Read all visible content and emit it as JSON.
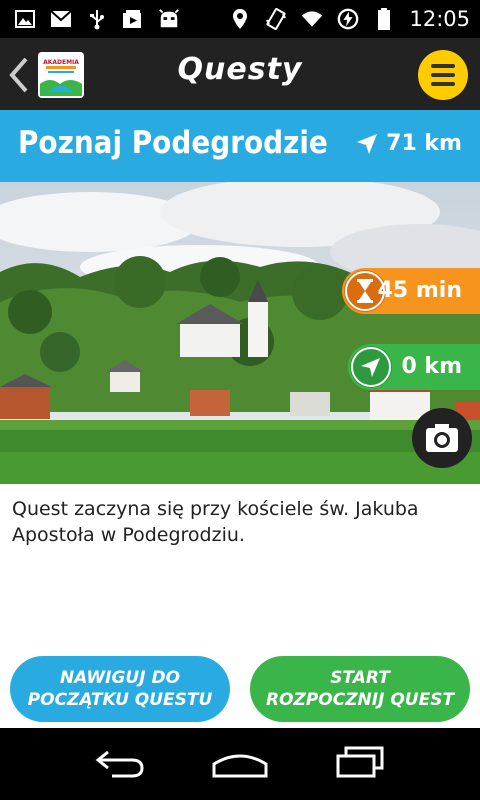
{
  "status_bar": {
    "time": "12:05",
    "left_icons": [
      "image-icon",
      "gmail-icon",
      "usb-icon",
      "media-icon",
      "android-icon"
    ],
    "right_icons": [
      "location-icon",
      "vibrate-icon",
      "wifi-icon",
      "sync-icon",
      "battery-icon"
    ]
  },
  "app_bar": {
    "title": "Questy",
    "logo_text": "AKADEMIA",
    "menu_color": "#ffcc00"
  },
  "quest": {
    "title": "Poznaj Podegrodzie",
    "distance": "71 km"
  },
  "info_pills": {
    "time": "45 min",
    "distance": "0 km"
  },
  "description": "Quest zaczyna się przy kościele św. Jakuba Apostoła w Podegrodziu.",
  "buttons": {
    "navigate_line1": "NAWIGUJ DO",
    "navigate_line2": "POCZĄTKU QUESTU",
    "start_line1": "START",
    "start_line2": "ROZPOCZNIJ QUEST"
  },
  "colors": {
    "header_blue": "#29abe2",
    "accent_orange": "#f7941d",
    "accent_green": "#39b54a",
    "app_bar": "#222222"
  }
}
